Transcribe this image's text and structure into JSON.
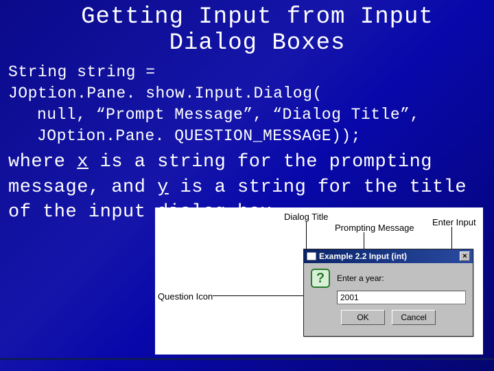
{
  "title": "Getting Input from Input Dialog Boxes",
  "code": {
    "l1": "String string =",
    "l2": "JOption.Pane. show.Input.Dialog(",
    "l3": "null, “Prompt Message”,  “Dialog Title”,",
    "l4": "JOption.Pane. QUESTION_MESSAGE));"
  },
  "desc_parts": {
    "p1": "where ",
    "x": "x",
    "p2": " is a string for the prompting message, and ",
    "y": "y",
    "p3": " is a string for the title of the input dialog box."
  },
  "figure": {
    "labels": {
      "dialog_title": "Dialog Title",
      "prompting_message": "Prompting Message",
      "enter_input": "Enter Input",
      "question_icon": "Question Icon"
    },
    "dialog": {
      "title": "Example 2.2 Input (int)",
      "prompt": "Enter a year:",
      "value": "2001",
      "ok": "OK",
      "cancel": "Cancel"
    }
  }
}
